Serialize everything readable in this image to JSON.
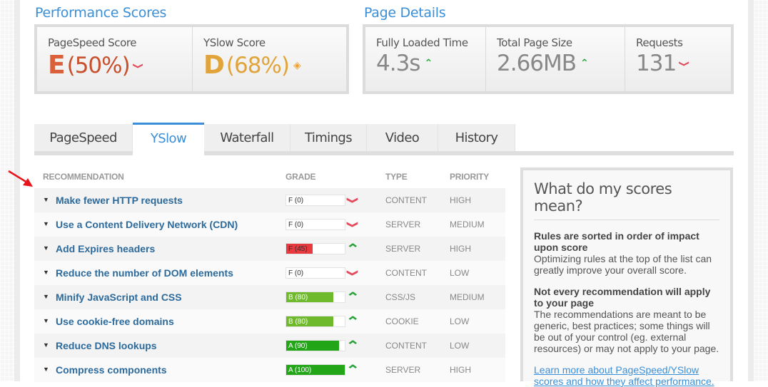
{
  "performance_scores": {
    "title": "Performance Scores",
    "pagespeed": {
      "label": "PageSpeed Score",
      "grade": "E",
      "percent": "(50%)",
      "trend": "down",
      "color": "#d9603a"
    },
    "yslow": {
      "label": "YSlow Score",
      "grade": "D",
      "percent": "(68%)",
      "trend": "neutral",
      "color": "#e0a43a"
    }
  },
  "page_details": {
    "title": "Page Details",
    "fully_loaded": {
      "label": "Fully Loaded Time",
      "value": "4.3s",
      "trend": "up"
    },
    "page_size": {
      "label": "Total Page Size",
      "value": "2.66MB",
      "trend": "up"
    },
    "requests": {
      "label": "Requests",
      "value": "131",
      "trend": "down"
    }
  },
  "tabs": [
    {
      "label": "PageSpeed",
      "active": false
    },
    {
      "label": "YSlow",
      "active": true
    },
    {
      "label": "Waterfall",
      "active": false
    },
    {
      "label": "Timings",
      "active": false
    },
    {
      "label": "Video",
      "active": false
    },
    {
      "label": "History",
      "active": false
    }
  ],
  "table": {
    "headers": {
      "recommendation": "RECOMMENDATION",
      "grade": "GRADE",
      "type": "TYPE",
      "priority": "PRIORITY"
    },
    "rows": [
      {
        "name": "Make fewer HTTP requests",
        "grade": "F (0)",
        "score": 0,
        "trend": "down",
        "type": "CONTENT",
        "priority": "HIGH"
      },
      {
        "name": "Use a Content Delivery Network (CDN)",
        "grade": "F (0)",
        "score": 0,
        "trend": "down",
        "type": "SERVER",
        "priority": "MEDIUM"
      },
      {
        "name": "Add Expires headers",
        "grade": "F (45)",
        "score": 45,
        "trend": "up",
        "type": "SERVER",
        "priority": "HIGH"
      },
      {
        "name": "Reduce the number of DOM elements",
        "grade": "F (0)",
        "score": 0,
        "trend": "down",
        "type": "CONTENT",
        "priority": "LOW"
      },
      {
        "name": "Minify JavaScript and CSS",
        "grade": "B (80)",
        "score": 80,
        "trend": "up",
        "type": "CSS/JS",
        "priority": "MEDIUM"
      },
      {
        "name": "Use cookie-free domains",
        "grade": "B (80)",
        "score": 80,
        "trend": "up",
        "type": "COOKIE",
        "priority": "LOW"
      },
      {
        "name": "Reduce DNS lookups",
        "grade": "A (90)",
        "score": 90,
        "trend": "up",
        "type": "CONTENT",
        "priority": "LOW"
      },
      {
        "name": "Compress components",
        "grade": "A (100)",
        "score": 100,
        "trend": "up",
        "type": "SERVER",
        "priority": "HIGH"
      }
    ]
  },
  "info_box": {
    "title": "What do my scores mean?",
    "section1_heading": "Rules are sorted in order of impact upon score",
    "section1_text": "Optimizing rules at the top of the list can greatly improve your overall score.",
    "section2_heading": "Not every recommendation will apply to your page",
    "section2_text": "The recommendations are meant to be generic, best practices; some things will be out of your control (eg. external resources) or may not apply to your page.",
    "link": "Learn more about PageSpeed/YSlow scores and how they affect performance."
  },
  "colors": {
    "accent": "#3a8fd8",
    "grade_f": "#e8393f",
    "grade_b": "#6fba2c",
    "grade_a": "#22a618",
    "trend_up": "#2aa43a",
    "trend_down": "#e24b5c"
  }
}
